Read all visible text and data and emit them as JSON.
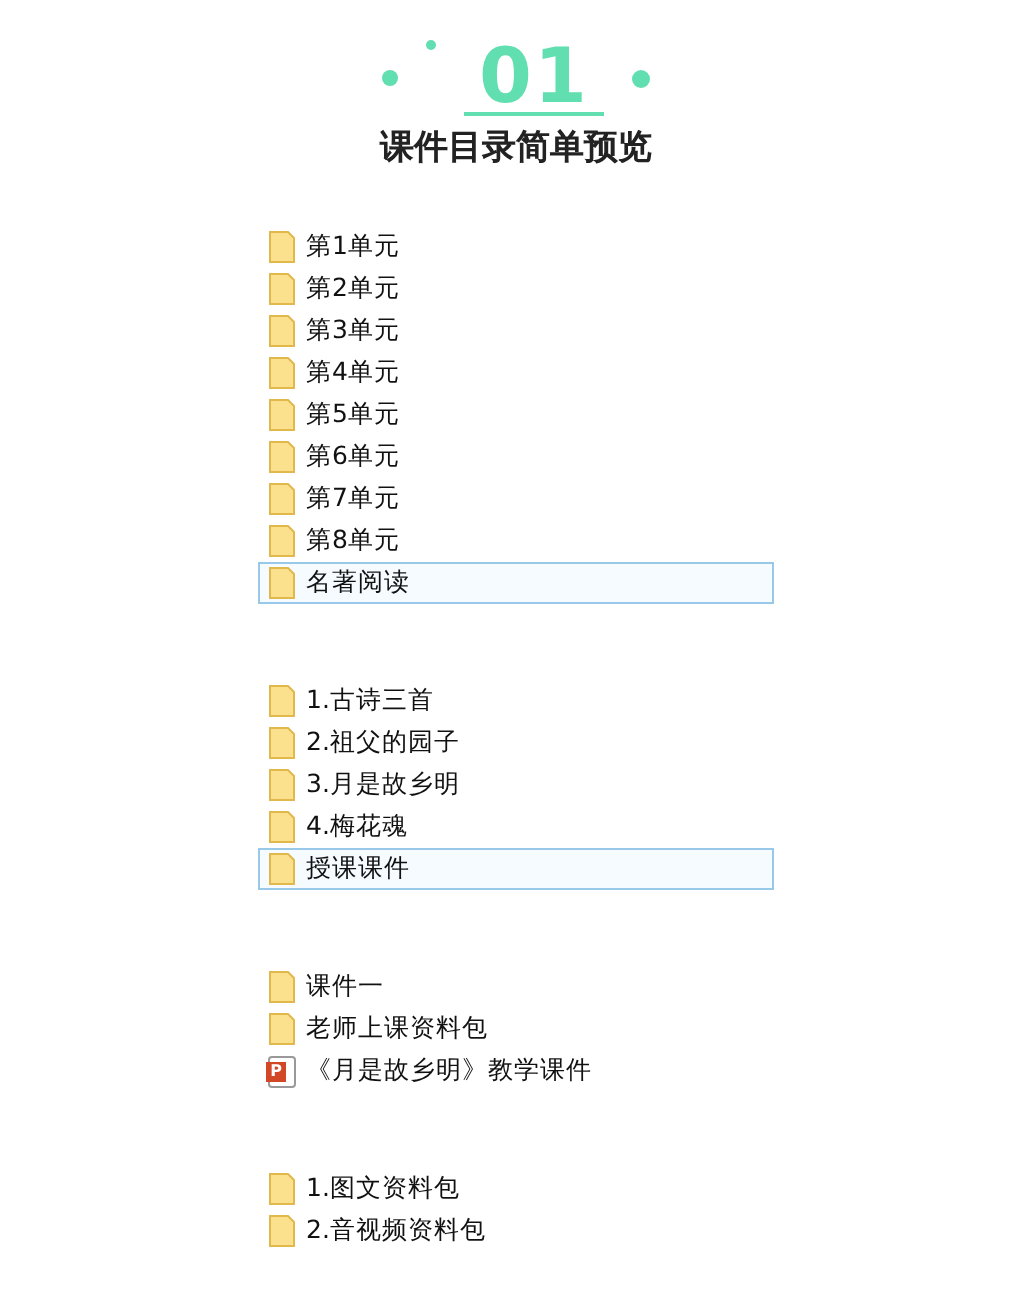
{
  "header": {
    "number": "01",
    "title": "课件目录简单预览"
  },
  "groups": [
    {
      "items": [
        {
          "kind": "folder",
          "name": "第1单元",
          "selected": false
        },
        {
          "kind": "folder",
          "name": "第2单元",
          "selected": false
        },
        {
          "kind": "folder",
          "name": "第3单元",
          "selected": false
        },
        {
          "kind": "folder",
          "name": "第4单元",
          "selected": false
        },
        {
          "kind": "folder",
          "name": "第5单元",
          "selected": false
        },
        {
          "kind": "folder",
          "name": "第6单元",
          "selected": false
        },
        {
          "kind": "folder",
          "name": "第7单元",
          "selected": false
        },
        {
          "kind": "folder",
          "name": "第8单元",
          "selected": false
        },
        {
          "kind": "folder",
          "name": "名著阅读",
          "selected": true
        }
      ]
    },
    {
      "items": [
        {
          "kind": "folder",
          "name": "1.古诗三首",
          "selected": false
        },
        {
          "kind": "folder",
          "name": "2.祖父的园子",
          "selected": false
        },
        {
          "kind": "folder",
          "name": "3.月是故乡明",
          "selected": false
        },
        {
          "kind": "folder",
          "name": "4.梅花魂",
          "selected": false
        },
        {
          "kind": "folder",
          "name": "授课课件",
          "selected": true
        }
      ]
    },
    {
      "items": [
        {
          "kind": "folder",
          "name": "课件一",
          "selected": false
        },
        {
          "kind": "folder",
          "name": "老师上课资料包",
          "selected": false
        },
        {
          "kind": "slides",
          "icon_label": "P",
          "name": "《月是故乡明》教学课件",
          "selected": false
        }
      ]
    },
    {
      "items": [
        {
          "kind": "folder",
          "name": "1.图文资料包",
          "selected": false
        },
        {
          "kind": "folder",
          "name": "2.音视频资料包",
          "selected": false
        }
      ]
    }
  ]
}
